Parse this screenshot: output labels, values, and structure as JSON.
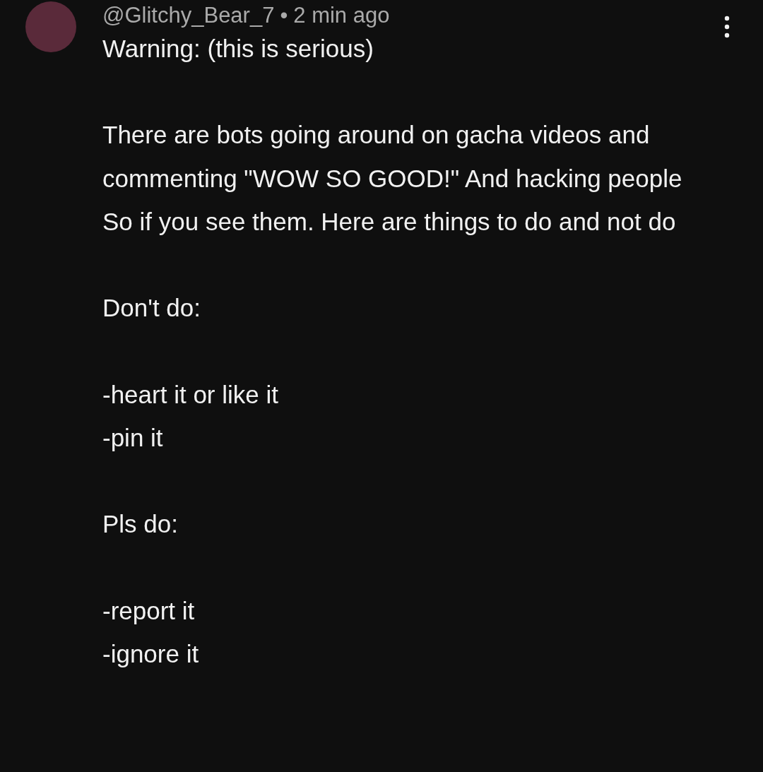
{
  "comment": {
    "author": "@Glitchy_Bear_7",
    "separator": "•",
    "time": "2 min ago",
    "body": "Warning: (this is serious)\n\nThere are bots going around on gacha videos and commenting \"WOW SO GOOD!\" And hacking people\nSo if you see them. Here are things to do and not do\n\nDon't do:\n\n-heart it or like it\n-pin it\n\nPls do:\n\n-report it\n-ignore it"
  }
}
